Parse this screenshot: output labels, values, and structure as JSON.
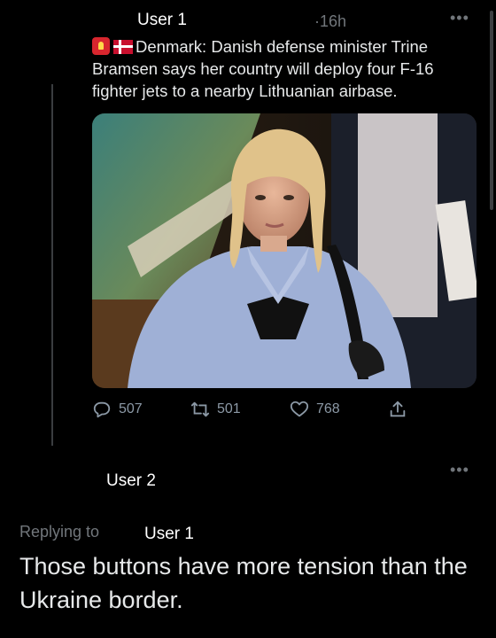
{
  "tweet": {
    "author": "User 1",
    "time": "·16h",
    "more": "•••",
    "emoji": [
      "siren-emoji",
      "denmark-flag-emoji"
    ],
    "text": "Denmark: Danish defense minister Trine Bramsen says her country will deploy four F-16 fighter jets to a nearby Lithuanian airbase.",
    "photo_alt": "Photo",
    "stats": {
      "replies": "507",
      "retweets": "501",
      "likes": "768"
    },
    "icons": [
      "reply-icon",
      "retweet-icon",
      "like-icon",
      "share-icon"
    ]
  },
  "reply": {
    "author": "User 2",
    "more": "•••",
    "replying_to_label": "Replying to",
    "replying_to_user": "User 1",
    "text": "Those buttons have more tension than the Ukraine border."
  },
  "colors": {
    "background": "#000000",
    "text": "#e7e9ea",
    "muted": "#71767b"
  }
}
